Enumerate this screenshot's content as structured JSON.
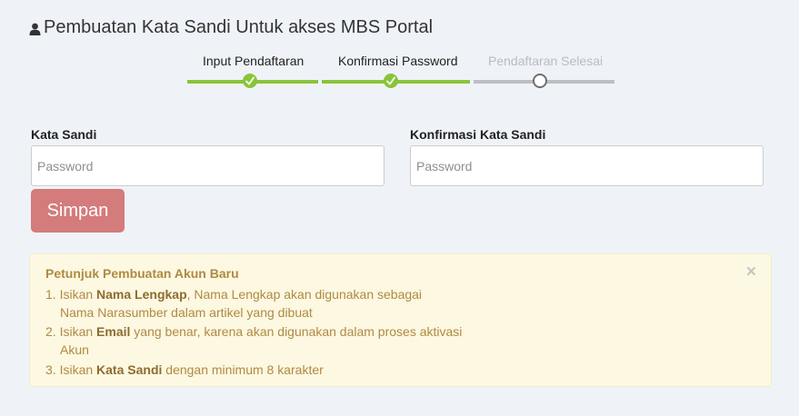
{
  "header": {
    "title": "Pembuatan Kata Sandi Untuk akses MBS Portal"
  },
  "steps": [
    {
      "label": "Input Pendaftaran",
      "status": "done"
    },
    {
      "label": "Konfirmasi Password",
      "status": "done"
    },
    {
      "label": "Pendaftaran Selesai",
      "status": "pending"
    }
  ],
  "form": {
    "password_label": "Kata Sandi",
    "password_placeholder": "Password",
    "confirm_label": "Konfirmasi Kata Sandi",
    "confirm_placeholder": "Password",
    "save_label": "Simpan"
  },
  "alert": {
    "title": "Petunjuk Pembuatan Akun Baru",
    "close": "×",
    "item1_prefix": "1. Isikan ",
    "item1_bold": "Nama Lengkap",
    "item1_suffix": ", Nama Lengkap akan digunakan sebagai",
    "item1_cont": "Nama Narasumber dalam artikel yang dibuat",
    "item2_prefix": "2. Isikan ",
    "item2_bold": "Email",
    "item2_suffix": " yang benar, karena akan digunakan dalam proses aktivasi",
    "item2_cont": "Akun",
    "item3_prefix": "3. Isikan ",
    "item3_bold": "Kata Sandi",
    "item3_suffix": " dengan minimum 8 karakter"
  },
  "colors": {
    "accent_done": "#89c43b",
    "pending": "#bdbfc4",
    "save_button": "#d47b7b",
    "alert_bg": "#fcf8e1",
    "alert_text": "#b08a43"
  },
  "icons": {
    "title": "user-icon",
    "step_done": "check-icon",
    "alert_close": "close-icon"
  }
}
